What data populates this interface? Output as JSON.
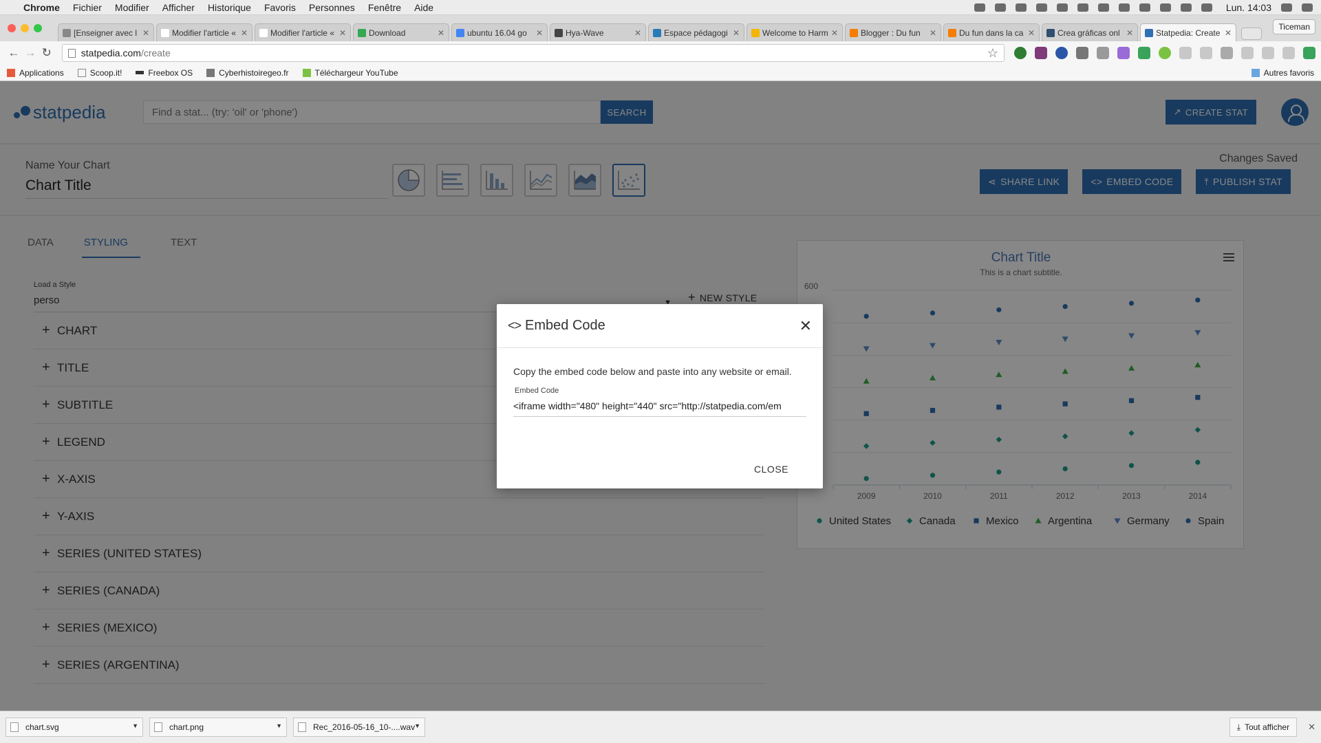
{
  "mac_menu": {
    "app": "Chrome",
    "items": [
      "Fichier",
      "Modifier",
      "Afficher",
      "Historique",
      "Favoris",
      "Personnes",
      "Fenêtre",
      "Aide"
    ],
    "clock": "Lun. 14:03"
  },
  "browser": {
    "tabs": [
      {
        "title": "[Enseigner avec l",
        "active": false,
        "color": "#888888"
      },
      {
        "title": "Modifier l'article «",
        "active": false,
        "color": "#ffffff"
      },
      {
        "title": "Modifier l'article «",
        "active": false,
        "color": "#ffffff"
      },
      {
        "title": "Download",
        "active": false,
        "color": "#34a853"
      },
      {
        "title": "ubuntu 16.04 go",
        "active": false,
        "color": "#4285f4"
      },
      {
        "title": "Hya-Wave",
        "active": false,
        "color": "#444444"
      },
      {
        "title": "Espace pédagogi",
        "active": false,
        "color": "#2a7ab8"
      },
      {
        "title": "Welcome to Harm",
        "active": false,
        "color": "#f2b600"
      },
      {
        "title": "Blogger : Du fun",
        "active": false,
        "color": "#f57d00"
      },
      {
        "title": "Du fun dans la ca",
        "active": false,
        "color": "#f57d00"
      },
      {
        "title": "Crea gráficas onl",
        "active": false,
        "color": "#2f4f6f"
      },
      {
        "title": "Statpedia: Create",
        "active": true,
        "color": "#2f6fb3"
      }
    ],
    "profile": "Ticeman",
    "url": "statpedia.com/create",
    "url_host": "statpedia.com",
    "url_path": "/create",
    "bookmarks": [
      "Applications",
      "Scoop.it!",
      "Freebox OS",
      "Cyberhistoiregeo.fr",
      "Téléchargeur YouTube"
    ],
    "bookmarks_other": "Autres favoris"
  },
  "app": {
    "logo": "statpedia",
    "search_placeholder": "Find a stat... (try: 'oil' or 'phone')",
    "search_button": "SEARCH",
    "create_stat": "CREATE STAT",
    "name_label": "Name Your Chart",
    "chart_title_input": "Chart Title",
    "changes_saved": "Changes Saved",
    "share_link": "SHARE LINK",
    "embed_code": "EMBED CODE",
    "publish_stat": "PUBLISH STAT",
    "tabs": [
      "DATA",
      "STYLING",
      "TEXT"
    ],
    "active_tab": "STYLING",
    "load_style_label": "Load a Style",
    "load_style_value": "perso",
    "new_style": "NEW STYLE",
    "sections": [
      "CHART",
      "TITLE",
      "SUBTITLE",
      "LEGEND",
      "X-AXIS",
      "Y-AXIS",
      "SERIES (UNITED STATES)",
      "SERIES (CANADA)",
      "SERIES (MEXICO)",
      "SERIES (ARGENTINA)"
    ]
  },
  "chart_data": {
    "type": "scatter",
    "title": "Chart Title",
    "subtitle": "This is a chart subtitle.",
    "ytick_labels": [
      "600"
    ],
    "x": [
      "2009",
      "2010",
      "2011",
      "2012",
      "2013",
      "2014"
    ],
    "ylim": [
      0,
      600
    ],
    "grid": true,
    "legend_position": "bottom",
    "series": [
      {
        "name": "United States",
        "marker": "circle",
        "color": "#1f9e8a",
        "values": [
          20,
          30,
          40,
          50,
          60,
          70
        ]
      },
      {
        "name": "Canada",
        "marker": "diamond",
        "color": "#1f9e8a",
        "values": [
          120,
          130,
          140,
          150,
          160,
          170
        ]
      },
      {
        "name": "Mexico",
        "marker": "square",
        "color": "#2f6fb3",
        "values": [
          220,
          230,
          240,
          250,
          260,
          270
        ]
      },
      {
        "name": "Argentina",
        "marker": "triangle",
        "color": "#3fae49",
        "values": [
          320,
          330,
          340,
          350,
          360,
          370
        ]
      },
      {
        "name": "Germany",
        "marker": "triangle-down",
        "color": "#5b8fc7",
        "values": [
          420,
          430,
          440,
          450,
          460,
          470
        ]
      },
      {
        "name": "Spain",
        "marker": "circle",
        "color": "#2f6fb3",
        "values": [
          520,
          530,
          540,
          550,
          560,
          570
        ]
      }
    ]
  },
  "modal": {
    "title": "Embed Code",
    "description": "Copy the embed code below and paste into any website or email.",
    "field_label": "Embed Code",
    "code": "<iframe width=\"480\" height=\"440\" src=\"http://statpedia.com/em",
    "close": "CLOSE"
  },
  "downloads": {
    "items": [
      "chart.svg",
      "chart.png",
      "Rec_2016-05-16_10-....wav"
    ],
    "show_all": "Tout afficher"
  },
  "colors": {
    "brand": "#2f6fb3",
    "overlay": "rgba(0,0,0,0.47)"
  }
}
